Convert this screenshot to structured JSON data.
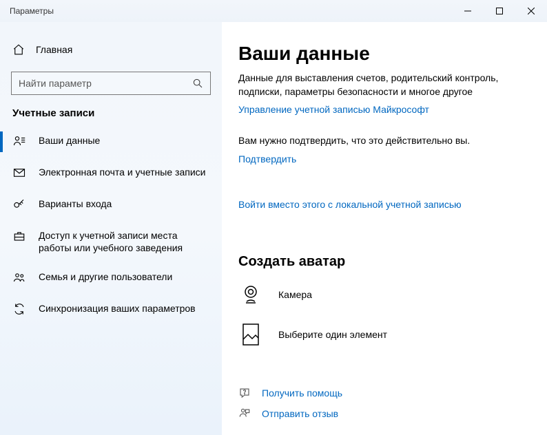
{
  "titlebar": {
    "title": "Параметры"
  },
  "sidebar": {
    "home_label": "Главная",
    "search_placeholder": "Найти параметр",
    "section_title": "Учетные записи",
    "items": [
      {
        "label": "Ваши данные"
      },
      {
        "label": "Электронная почта и учетные записи"
      },
      {
        "label": "Варианты входа"
      },
      {
        "label": "Доступ к учетной записи места работы или учебного заведения"
      },
      {
        "label": "Семья и другие пользователи"
      },
      {
        "label": "Синхронизация ваших параметров"
      }
    ]
  },
  "main": {
    "heading": "Ваши данные",
    "description": "Данные для выставления счетов, родительский контроль, подписки, параметры безопасности и многое другое",
    "manage_link": "Управление учетной записью Майкрософт",
    "verify_text": "Вам нужно подтвердить, что это действительно вы.",
    "verify_link": "Подтвердить",
    "local_signin_link": "Войти вместо этого с локальной учетной записью",
    "avatar_heading": "Создать аватар",
    "camera_label": "Камера",
    "browse_label": "Выберите один элемент",
    "help_label": "Получить помощь",
    "feedback_label": "Отправить отзыв"
  }
}
